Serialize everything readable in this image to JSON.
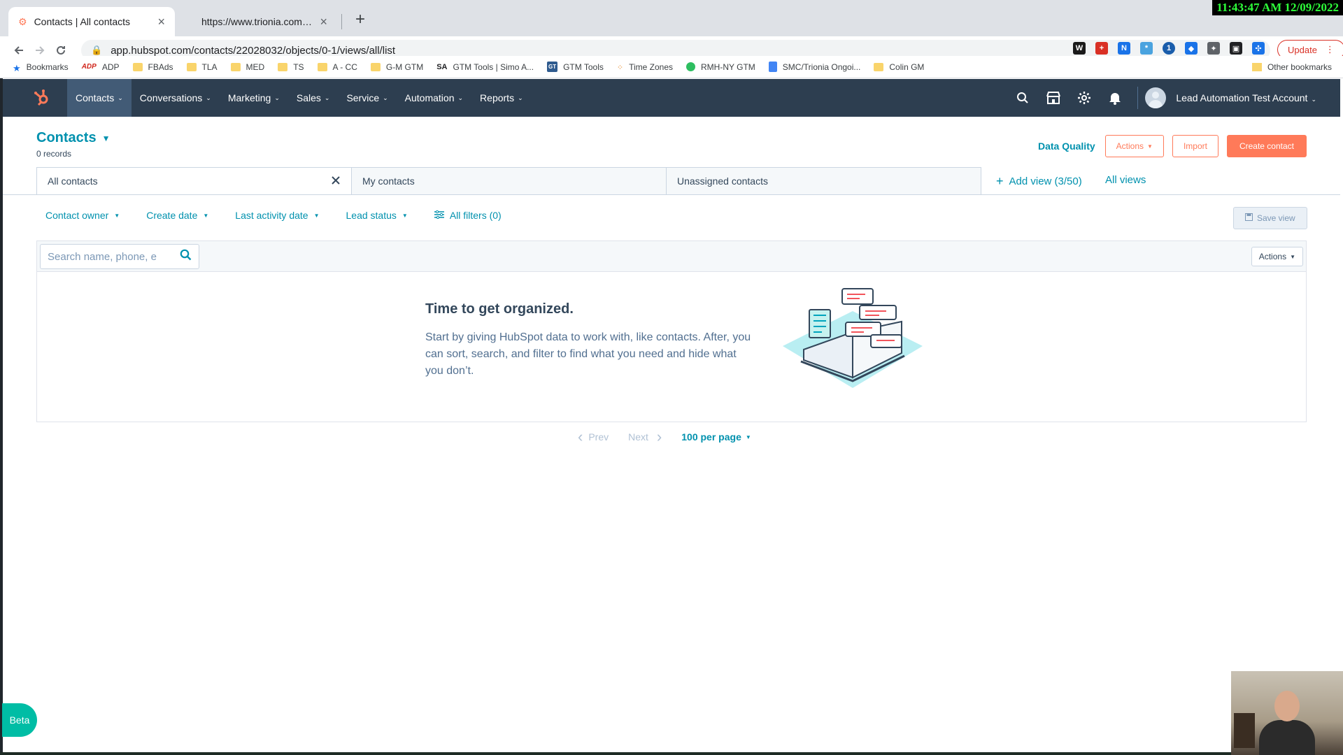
{
  "browser": {
    "clock": "11:43:47 AM 12/09/2022",
    "tabs": [
      {
        "title": "Contacts | All contacts"
      },
      {
        "title": "https://www.trionia.com/medrio/"
      }
    ],
    "url": "app.hubspot.com/contacts/22028032/objects/0-1/views/all/list",
    "update_label": "Update",
    "bookmarks": [
      {
        "label": "Bookmarks",
        "icon": "star-icon"
      },
      {
        "label": "ADP",
        "icon": "adp-logo"
      },
      {
        "label": "FBAds",
        "icon": "folder-icon"
      },
      {
        "label": "TLA",
        "icon": "folder-icon"
      },
      {
        "label": "MED",
        "icon": "folder-icon"
      },
      {
        "label": "TS",
        "icon": "folder-icon"
      },
      {
        "label": "A - CC",
        "icon": "folder-icon"
      },
      {
        "label": "G-M GTM",
        "icon": "folder-icon"
      },
      {
        "label": "GTM Tools | Simo A...",
        "icon": "simo-icon"
      },
      {
        "label": "GTM Tools",
        "icon": "gt-icon"
      },
      {
        "label": "Time Zones",
        "icon": "dots-icon"
      },
      {
        "label": "RMH-NY GTM",
        "icon": "evernote-icon"
      },
      {
        "label": "SMC/Trionia Ongoi...",
        "icon": "doc-icon"
      },
      {
        "label": "Colin GM",
        "icon": "folder-icon"
      }
    ],
    "other_bookmarks": "Other bookmarks",
    "extensions": [
      {
        "label": "W",
        "color": "#1a1a1a"
      },
      {
        "label": "+",
        "color": "#d93025"
      },
      {
        "label": "N",
        "color": "#1a73e8"
      },
      {
        "label": "*",
        "color": "#4aa3df"
      },
      {
        "label": "1",
        "color": "#1a5dab"
      },
      {
        "label": "◆",
        "color": "#1a73e8"
      },
      {
        "label": "✦",
        "color": "#5f6368"
      },
      {
        "label": "▣",
        "color": "#202124"
      },
      {
        "label": "✣",
        "color": "#1a73e8"
      }
    ]
  },
  "hubspot": {
    "nav": [
      "Contacts",
      "Conversations",
      "Marketing",
      "Sales",
      "Service",
      "Automation",
      "Reports"
    ],
    "account": "Lead Automation Test Account",
    "page_title": "Contacts",
    "records": "0 records",
    "data_quality": "Data Quality",
    "actions": "Actions",
    "import": "Import",
    "create_contact": "Create contact",
    "view_tabs": [
      "All contacts",
      "My contacts",
      "Unassigned contacts"
    ],
    "add_view": "Add view (3/50)",
    "all_views": "All views",
    "filters": [
      "Contact owner",
      "Create date",
      "Last activity date",
      "Lead status"
    ],
    "all_filters": "All filters (0)",
    "save_view": "Save view",
    "search_placeholder": "Search name, phone, e",
    "table_actions": "Actions",
    "empty_title": "Time to get organized.",
    "empty_text": "Start by giving HubSpot data to work with, like contacts. After, you can sort, search, and filter to find what you need and hide what you don’t.",
    "pagination": {
      "prev": "Prev",
      "next": "Next",
      "per_page": "100 per page"
    },
    "beta": "Beta",
    "colors": {
      "nav_bg": "#2d3e50",
      "accent": "#0091ae",
      "primary": "#ff7a59",
      "beta": "#00bda5"
    }
  }
}
